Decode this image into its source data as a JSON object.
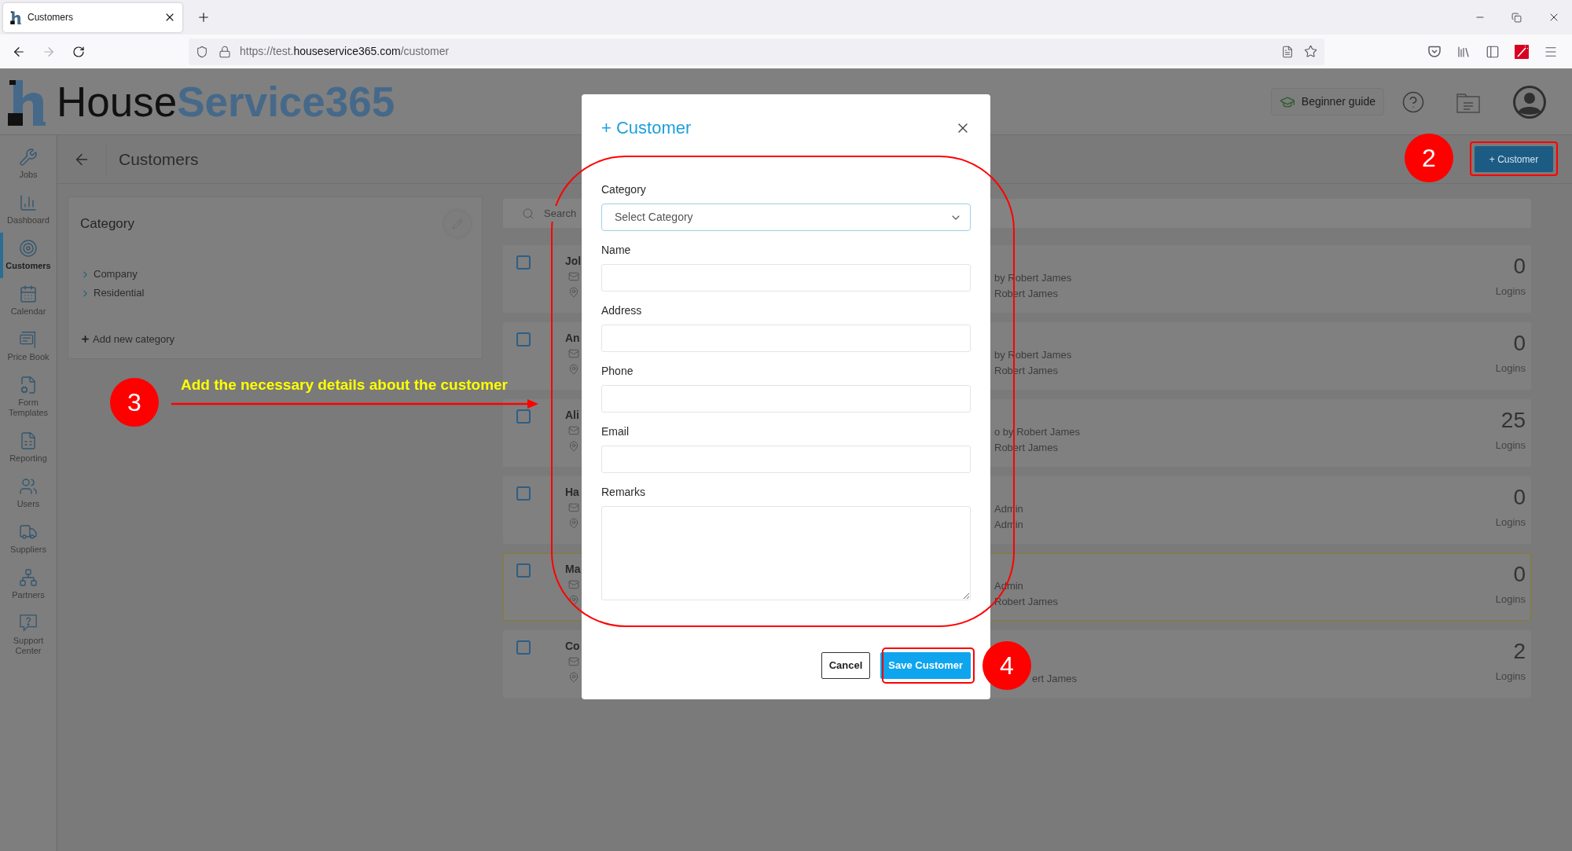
{
  "browser": {
    "tab": {
      "title": "Customers"
    },
    "url": {
      "scheme": "https://test.",
      "host": "houseservice365.com",
      "path": "/customer"
    }
  },
  "header": {
    "brand": {
      "first": "House",
      "second": "Service365"
    },
    "guide_button": "Beginner guide"
  },
  "sidebar": {
    "items": [
      {
        "label": "Jobs",
        "selected": false
      },
      {
        "label": "Dashboard",
        "selected": false
      },
      {
        "label": "Customers",
        "selected": true
      },
      {
        "label": "Calendar",
        "selected": false
      },
      {
        "label": "Price Book",
        "selected": false
      },
      {
        "label": "Form Templates",
        "selected": false
      },
      {
        "label": "Reporting",
        "selected": false
      },
      {
        "label": "Users",
        "selected": false
      },
      {
        "label": "Suppliers",
        "selected": false
      },
      {
        "label": "Partners",
        "selected": false
      },
      {
        "label": "Support Center",
        "selected": false
      }
    ]
  },
  "page": {
    "title": "Customers",
    "add_button": "+ Customer"
  },
  "category_panel": {
    "title": "Category",
    "items": [
      {
        "label": "Company",
        "expanded": false
      },
      {
        "label": "Residential",
        "expanded": false
      }
    ],
    "add_link": "Add new category"
  },
  "customer_list": {
    "search": {
      "placeholder": "Search"
    },
    "rows": [
      {
        "name": "Jol",
        "checked": false,
        "selected": false,
        "line_1": "by Robert James",
        "line_2": "Robert James",
        "count": "0",
        "count_label": "Logins"
      },
      {
        "name": "An",
        "checked": false,
        "selected": false,
        "line_1": "by Robert James",
        "line_2": "Robert James",
        "count": "0",
        "count_label": "Logins"
      },
      {
        "name": "Ali",
        "checked": false,
        "selected": false,
        "line_1": "o by Robert James",
        "line_2": "Robert James",
        "count": "25",
        "count_label": "Logins"
      },
      {
        "name": "Ha",
        "checked": false,
        "selected": false,
        "line_1": "Admin",
        "line_2": "Admin",
        "count": "0",
        "count_label": "Logins"
      },
      {
        "name": "Ma",
        "checked": false,
        "selected": true,
        "line_1": "Admin",
        "line_2": "Robert James",
        "count": "0",
        "count_label": "Logins"
      },
      {
        "name": "Co",
        "checked": false,
        "selected": false,
        "line_2": "ert James",
        "count": "2",
        "count_label": "Logins"
      }
    ]
  },
  "modal": {
    "title": "+ Customer",
    "fields": [
      {
        "label": "Category",
        "kind": "select",
        "placeholder": "Select Category"
      },
      {
        "label": "Name",
        "kind": "text"
      },
      {
        "label": "Address",
        "kind": "text"
      },
      {
        "label": "Phone",
        "kind": "text"
      },
      {
        "label": "Email",
        "kind": "text"
      },
      {
        "label": "Remarks",
        "kind": "textarea"
      }
    ],
    "buttons": [
      {
        "label": "Cancel",
        "kind": "secondary"
      },
      {
        "label": "Save Customer",
        "kind": "primary"
      }
    ]
  },
  "annotations": [
    {
      "step": "2"
    },
    {
      "step": "3",
      "caption": "Add the necessary details about the customer"
    },
    {
      "step": "4"
    }
  ]
}
